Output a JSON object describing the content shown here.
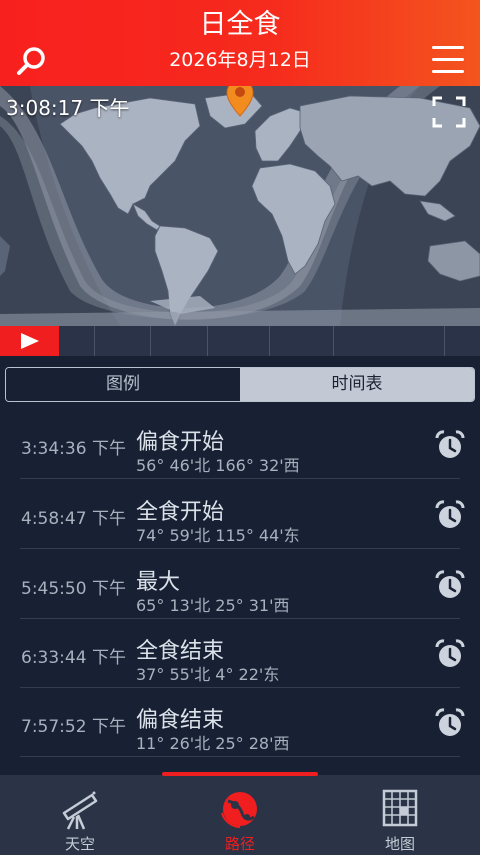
{
  "header": {
    "title": "日全食",
    "date": "2026年8月12日"
  },
  "map": {
    "current_time": "3:08:17 下午"
  },
  "tabs": {
    "legend": "图例",
    "schedule": "时间表"
  },
  "events": [
    {
      "time": "3:34:36 下午",
      "name": "偏食开始",
      "coords": "56° 46'北 166° 32'西"
    },
    {
      "time": "4:58:47 下午",
      "name": "全食开始",
      "coords": "74° 59'北 115° 44'东"
    },
    {
      "time": "5:45:50 下午",
      "name": "最大",
      "coords": "65° 13'北 25° 31'西"
    },
    {
      "time": "6:33:44 下午",
      "name": "全食结束",
      "coords": "37° 55'北 4° 22'东"
    },
    {
      "time": "7:57:52 下午",
      "name": "偏食结束",
      "coords": "11° 26'北 25° 28'西"
    }
  ],
  "nav": {
    "sky": "天空",
    "path": "路径",
    "map": "地图"
  },
  "colors": {
    "accent": "#f01e1e",
    "background": "#182033",
    "header_start": "#f8201e",
    "header_end": "#f4541e"
  },
  "icons": {
    "search": "search-icon",
    "menu": "hamburger-menu-icon",
    "fullscreen": "fullscreen-icon",
    "location": "location-pin-icon",
    "play": "play-icon",
    "alarm": "alarm-clock-icon",
    "sky": "telescope-icon",
    "path": "eclipse-path-icon",
    "map": "map-grid-icon"
  }
}
